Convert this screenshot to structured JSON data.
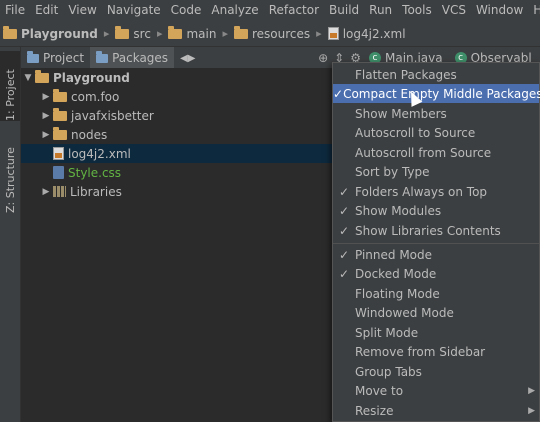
{
  "menubar": [
    "File",
    "Edit",
    "View",
    "Navigate",
    "Code",
    "Analyze",
    "Refactor",
    "Build",
    "Run",
    "Tools",
    "VCS",
    "Window",
    "Help"
  ],
  "breadcrumb": [
    "Playground",
    "src",
    "main",
    "resources",
    "log4j2.xml"
  ],
  "side_tabs": {
    "project": "1: Project",
    "structure": "Z: Structure"
  },
  "panel_tabs": {
    "project": "Project",
    "packages": "Packages"
  },
  "editor_tabs": [
    "Main.java",
    "Observabl"
  ],
  "tree": {
    "root": "Playground",
    "items": [
      {
        "label": "com.foo"
      },
      {
        "label": "javafxisbetter"
      },
      {
        "label": "nodes"
      },
      {
        "label": "log4j2.xml"
      },
      {
        "label": "Style.css"
      },
      {
        "label": "Libraries"
      }
    ]
  },
  "context_menu": {
    "items": [
      {
        "label": "Flatten Packages",
        "checked": false
      },
      {
        "label": "Compact Empty Middle Packages",
        "checked": true
      },
      {
        "label": "Show Members",
        "checked": false
      },
      {
        "label": "Autoscroll to Source",
        "checked": false
      },
      {
        "label": "Autoscroll from Source",
        "checked": false
      },
      {
        "label": "Sort by Type",
        "checked": false
      },
      {
        "label": "Folders Always on Top",
        "checked": true
      },
      {
        "label": "Show Modules",
        "checked": true
      },
      {
        "label": "Show Libraries Contents",
        "checked": true
      },
      {
        "label": "Pinned Mode",
        "checked": true
      },
      {
        "label": "Docked Mode",
        "checked": true
      },
      {
        "label": "Floating Mode",
        "checked": false
      },
      {
        "label": "Windowed Mode",
        "checked": false
      },
      {
        "label": "Split Mode",
        "checked": false
      },
      {
        "label": "Remove from Sidebar",
        "checked": false
      },
      {
        "label": "Group Tabs",
        "checked": false
      },
      {
        "label": "Move to",
        "checked": false,
        "submenu": true
      },
      {
        "label": "Resize",
        "checked": false,
        "submenu": true
      }
    ]
  },
  "colors": {
    "accent": "#4b6eaf",
    "selection": "#0d293e",
    "background": "#2b2b2b",
    "chrome": "#3c3f41",
    "css_file": "#62b543"
  }
}
